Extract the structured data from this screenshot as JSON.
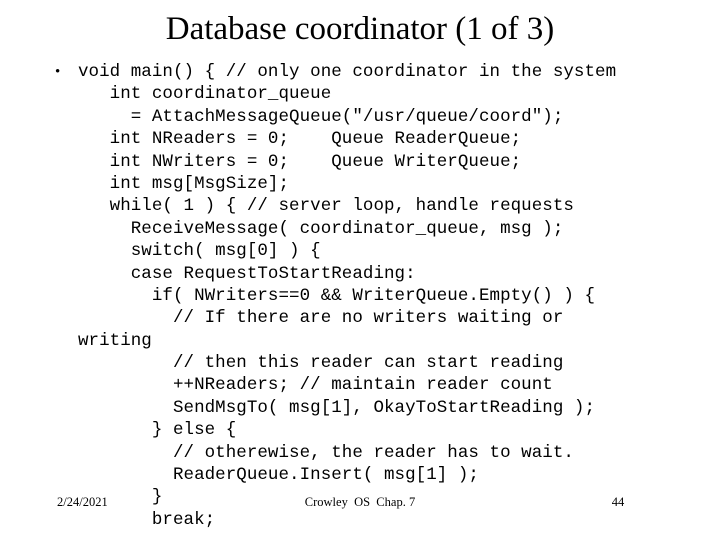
{
  "slide": {
    "title": "Database coordinator (1 of 3)",
    "background_color": "#ffffff",
    "text_color": "#000000"
  },
  "body": {
    "bullet_glyph": "•",
    "lines": [
      {
        "bullet": true,
        "text": "void main() { // only one coordinator in the system"
      },
      {
        "bullet": false,
        "text": "   int coordinator_queue"
      },
      {
        "bullet": false,
        "text": "     = AttachMessageQueue(\"/usr/queue/coord\");"
      },
      {
        "bullet": false,
        "text": "   int NReaders = 0;    Queue ReaderQueue;"
      },
      {
        "bullet": false,
        "text": "   int NWriters = 0;    Queue WriterQueue;"
      },
      {
        "bullet": false,
        "text": "   int msg[MsgSize];"
      },
      {
        "bullet": false,
        "text": "   while( 1 ) { // server loop, handle requests"
      },
      {
        "bullet": false,
        "text": "     ReceiveMessage( coordinator_queue, msg );"
      },
      {
        "bullet": false,
        "text": "     switch( msg[0] ) {"
      },
      {
        "bullet": false,
        "text": "     case RequestToStartReading:"
      },
      {
        "bullet": false,
        "text": "       if( NWriters==0 && WriterQueue.Empty() ) {"
      },
      {
        "bullet": false,
        "text": "         // If there are no writers waiting or"
      },
      {
        "bullet": false,
        "text": "writing"
      },
      {
        "bullet": false,
        "text": "         // then this reader can start reading"
      },
      {
        "bullet": false,
        "text": "         ++NReaders; // maintain reader count"
      },
      {
        "bullet": false,
        "text": "         SendMsgTo( msg[1], OkayToStartReading );"
      },
      {
        "bullet": false,
        "text": "       } else {"
      },
      {
        "bullet": false,
        "text": "         // otherewise, the reader has to wait."
      },
      {
        "bullet": false,
        "text": "         ReaderQueue.Insert( msg[1] );"
      },
      {
        "bullet": false,
        "text": "       }"
      },
      {
        "bullet": false,
        "text": "       break;"
      }
    ]
  },
  "footer": {
    "date": "2/24/2021",
    "center": "Crowley  OS  Chap. 7",
    "page_number": "44"
  }
}
